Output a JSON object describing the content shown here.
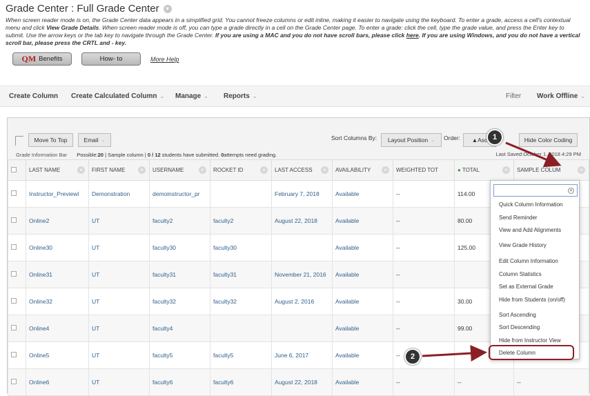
{
  "page": {
    "title": "Grade Center : Full Grade Center"
  },
  "instructions": {
    "part1": "When screen reader mode is on, the Grade Center data appears in a simplified grid. You cannot freeze columns or edit inline, making it easier to navigate using the keyboard. To enter a grade, access a cell's contextual menu and click ",
    "bold1": "View Grade Details",
    "part2": ". When screen reader mode is off, you can type a grade directly in a cell on the Grade Center page. To enter a grade: click the cell, type the grade value, and press the Enter key to submit. Use the arrow keys or the tab key to navigate through the Grade Center. ",
    "bold2": "If you are using a MAC and you do not have scroll bars, please click ",
    "here": "here",
    "bold3": ". If you are using Windows, and you do not have a vertical scroll bar, please press the CRTL and - key."
  },
  "buttons": {
    "qm_logo": "QM",
    "qm_label": "Benefits",
    "howto": "How- to",
    "more_help": "More Help"
  },
  "action_bar": {
    "create_column": "Create Column",
    "create_calculated": "Create Calculated Column",
    "manage": "Manage",
    "reports": "Reports",
    "filter": "Filter",
    "work_offline": "Work Offline"
  },
  "toolbar": {
    "move_to_top": "Move To Top",
    "email": "Email",
    "sort_columns_by": "Sort Columns By:",
    "layout_position": "Layout Position",
    "order": "Order:",
    "ascending": "▲Asc",
    "hide_color_coding": "Hide Color Coding"
  },
  "info_bar": {
    "label": "Grade Information Bar",
    "possible_label": "Possible: ",
    "possible_value": "20",
    "column": " | Sample column | ",
    "submitted_count": "0 / 12",
    "submitted_text": " students have submitted. ",
    "attempts_count": "0",
    "attempts_text": " attempts need grading.",
    "last_saved": "Last Saved:October 1, 2018 4:29 PM"
  },
  "columns": [
    "LAST NAME",
    "FIRST NAME",
    "USERNAME",
    "ROCKET ID",
    "LAST ACCESS",
    "AVAILABILITY",
    "WEIGHTED TOT",
    "TOTAL",
    "SAMPLE COLUM"
  ],
  "rows": [
    [
      "Instructor_Previewl",
      "Demonstration",
      "demoinstructor_pr",
      "",
      "February 7, 2018",
      "Available",
      "--",
      "114.00",
      ""
    ],
    [
      "Online2",
      "UT",
      "faculty2",
      "faculty2",
      "August 22, 2018",
      "Available",
      "--",
      "80.00",
      ""
    ],
    [
      "Online30",
      "UT",
      "faculty30",
      "faculty30",
      "",
      "Available",
      "--",
      "125.00",
      ""
    ],
    [
      "Online31",
      "UT",
      "faculty31",
      "faculty31",
      "November 21, 2016",
      "Available",
      "--",
      "",
      ""
    ],
    [
      "Online32",
      "UT",
      "faculty32",
      "faculty32",
      "August 2, 2016",
      "Available",
      "--",
      "30.00",
      ""
    ],
    [
      "Online4",
      "UT",
      "faculty4",
      "",
      "",
      "Available",
      "--",
      "99.00",
      ""
    ],
    [
      "Online5",
      "UT",
      "faculty5",
      "faculty5",
      "June 6, 2017",
      "Available",
      "--",
      "",
      ""
    ],
    [
      "Online6",
      "UT",
      "faculty6",
      "faculty6",
      "August 22, 2018",
      "Available",
      "--",
      "--",
      "--"
    ]
  ],
  "menu": {
    "items": [
      "Quick Column Information",
      "Send Reminder",
      "View and Add Alignments",
      "View Grade History",
      "Edit Column Information",
      "Column Statistics",
      "Set as External Grade",
      "Hide from Students (on/off)",
      "Sort Ascending",
      "Sort Descending",
      "Hide from Instructor View",
      "Delete Column"
    ]
  },
  "callouts": [
    "1",
    "2"
  ],
  "colors": {
    "callout_arrow": "#8b1f25",
    "link": "#2e5f8a",
    "qm_red": "#b3201f"
  }
}
